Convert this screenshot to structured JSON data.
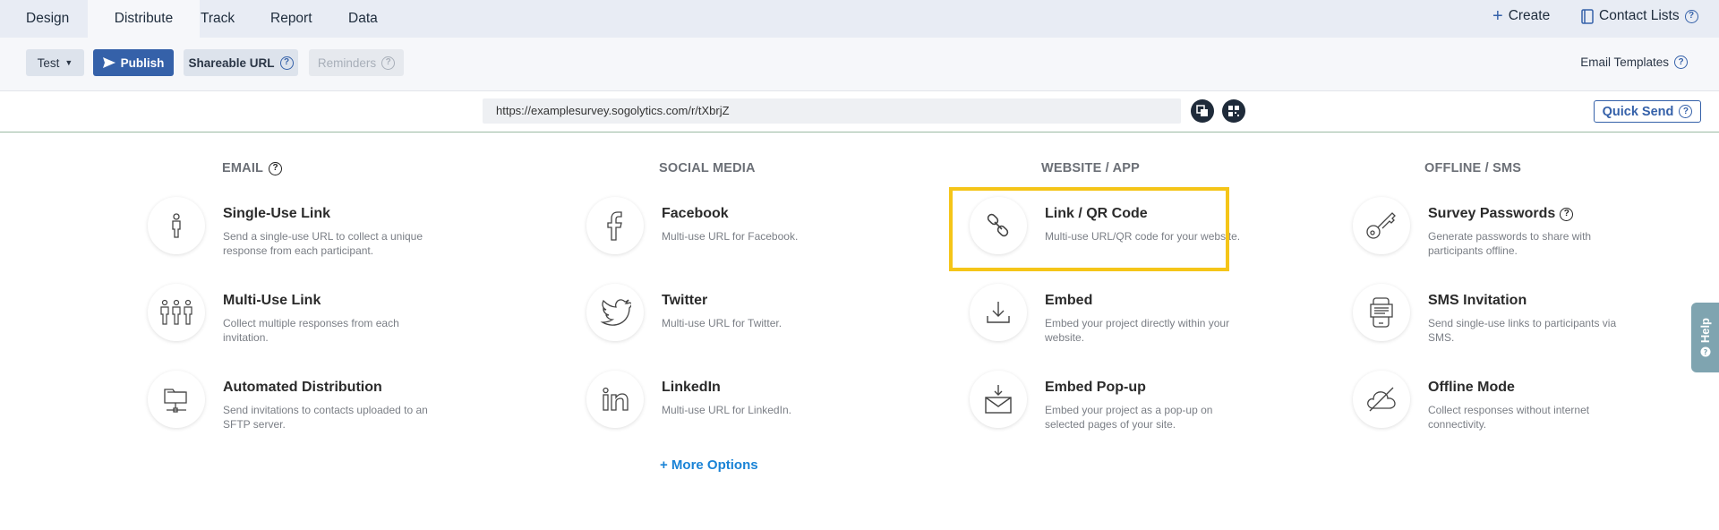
{
  "tabs": [
    "Design",
    "Distribute",
    "Track",
    "Report",
    "Data"
  ],
  "top_right": {
    "create": "Create",
    "contact_lists": "Contact Lists"
  },
  "toolbar": {
    "test": "Test",
    "publish": "Publish",
    "shareable_url": "Shareable URL",
    "reminders": "Reminders",
    "email_templates": "Email Templates"
  },
  "url_row": {
    "url": "https://examplesurvey.sogolytics.com/r/tXbrjZ",
    "quick_send": "Quick Send"
  },
  "columns": {
    "email": {
      "heading": "EMAIL",
      "items": [
        {
          "title": "Single-Use Link",
          "desc": "Send a single-use URL to collect a unique response from each participant.",
          "icon": "person-icon"
        },
        {
          "title": "Multi-Use Link",
          "desc": "Collect multiple responses from each invitation.",
          "icon": "group-icon"
        },
        {
          "title": "Automated Distribution",
          "desc": "Send invitations to contacts uploaded to an SFTP server.",
          "icon": "folder-network-icon"
        }
      ]
    },
    "social": {
      "heading": "SOCIAL MEDIA",
      "items": [
        {
          "title": "Facebook",
          "desc": "Multi-use URL for Facebook.",
          "icon": "facebook-icon"
        },
        {
          "title": "Twitter",
          "desc": "Multi-use URL for Twitter.",
          "icon": "twitter-icon"
        },
        {
          "title": "LinkedIn",
          "desc": "Multi-use URL for LinkedIn.",
          "icon": "linkedin-icon"
        }
      ],
      "more_options": "+ More Options"
    },
    "website": {
      "heading": "WEBSITE / APP",
      "items": [
        {
          "title": "Link / QR Code",
          "desc": "Multi-use URL/QR code for your website.",
          "icon": "link-icon"
        },
        {
          "title": "Embed",
          "desc": "Embed your project directly within your website.",
          "icon": "download-icon"
        },
        {
          "title": "Embed Pop-up",
          "desc": "Embed your project as a pop-up on selected pages of your site.",
          "icon": "envelope-download-icon"
        }
      ]
    },
    "offline": {
      "heading": "OFFLINE / SMS",
      "items": [
        {
          "title": "Survey Passwords",
          "desc": "Generate passwords to share with participants offline.",
          "icon": "key-icon"
        },
        {
          "title": "SMS Invitation",
          "desc": "Send single-use links to participants via SMS.",
          "icon": "phone-message-icon"
        },
        {
          "title": "Offline Mode",
          "desc": "Collect responses without internet connectivity.",
          "icon": "cloud-off-icon"
        }
      ]
    }
  },
  "help_tab": "Help",
  "colors": {
    "primary": "#3561a9",
    "highlight": "#f5c518",
    "link": "#1a83d6"
  }
}
